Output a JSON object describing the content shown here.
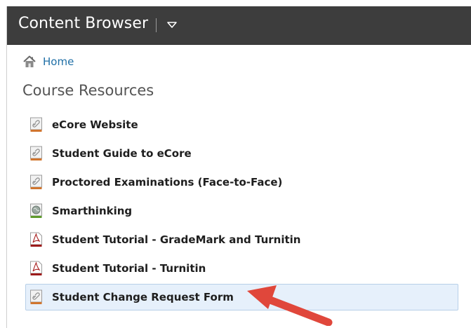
{
  "header": {
    "title": "Content Browser",
    "menu_icon": "triangle-down-icon"
  },
  "breadcrumb": {
    "home_label": "Home",
    "home_icon": "house-icon"
  },
  "section": {
    "title": "Course Resources"
  },
  "resources": [
    {
      "label": "eCore Website",
      "icon": "link-icon",
      "selected": false
    },
    {
      "label": "Student Guide to eCore",
      "icon": "link-icon",
      "selected": false
    },
    {
      "label": "Proctored Examinations (Face-to-Face)",
      "icon": "link-icon",
      "selected": false
    },
    {
      "label": "Smarthinking",
      "icon": "globe-icon",
      "selected": false
    },
    {
      "label": "Student Tutorial - GradeMark and Turnitin",
      "icon": "pdf-icon",
      "selected": false
    },
    {
      "label": "Student Tutorial - Turnitin",
      "icon": "pdf-icon",
      "selected": false
    },
    {
      "label": "Student Change Request Form",
      "icon": "link-icon",
      "selected": true
    }
  ],
  "colors": {
    "header_bg": "#3d3d3d",
    "link": "#1f6fa6",
    "selected_bg": "#e6f0fb",
    "annotation_arrow": "#e0473b"
  }
}
